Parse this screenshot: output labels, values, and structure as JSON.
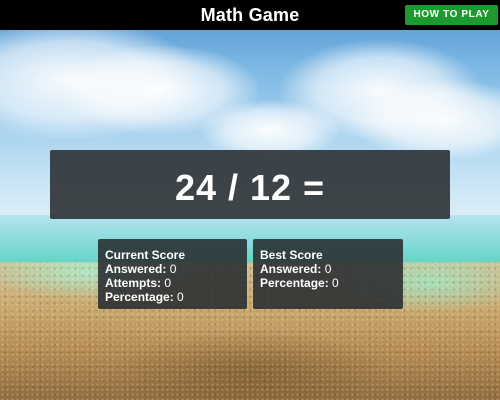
{
  "header": {
    "title": "Math Game",
    "how_to_play_label": "HOW TO PLAY"
  },
  "question": {
    "text": "24 / 12 ="
  },
  "current_score": {
    "heading": "Current Score",
    "answered_label": "Answered:",
    "answered_value": "0",
    "attempts_label": "Attempts:",
    "attempts_value": "0",
    "percentage_label": "Percentage:",
    "percentage_value": "0"
  },
  "best_score": {
    "heading": "Best Score",
    "answered_label": "Answered:",
    "answered_value": "0",
    "percentage_label": "Percentage:",
    "percentage_value": "0"
  },
  "colors": {
    "header_bg": "#000000",
    "button_green": "#1d9a2f",
    "panel_bg": "#282c30"
  }
}
